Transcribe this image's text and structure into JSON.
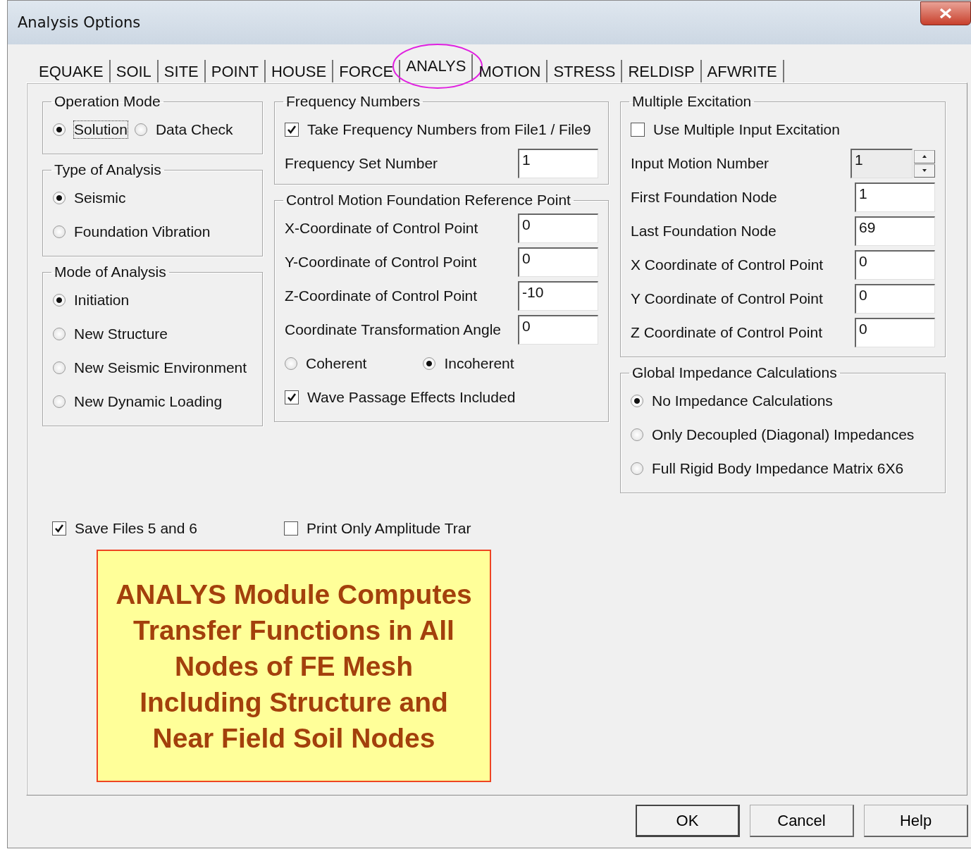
{
  "window": {
    "title": "Analysis Options"
  },
  "tabs": [
    {
      "label": "EQUAKE",
      "selected": false,
      "circled": false
    },
    {
      "label": "SOIL",
      "selected": false,
      "circled": false
    },
    {
      "label": "SITE",
      "selected": false,
      "circled": false
    },
    {
      "label": "POINT",
      "selected": false,
      "circled": false
    },
    {
      "label": "HOUSE",
      "selected": false,
      "circled": false
    },
    {
      "label": "FORCE",
      "selected": false,
      "circled": false
    },
    {
      "label": "ANALYS",
      "selected": true,
      "circled": true
    },
    {
      "label": "MOTION",
      "selected": false,
      "circled": false
    },
    {
      "label": "STRESS",
      "selected": false,
      "circled": false
    },
    {
      "label": "RELDISP",
      "selected": false,
      "circled": false
    },
    {
      "label": "AFWRITE",
      "selected": false,
      "circled": false
    }
  ],
  "columns": [
    {
      "groups": [
        {
          "title": "Operation Mode",
          "items": [
            {
              "kind": "radio_row",
              "options": [
                {
                  "label": "Solution",
                  "selected": true,
                  "focused": true
                },
                {
                  "label": "Data Check",
                  "selected": false,
                  "focused": false
                }
              ]
            }
          ]
        },
        {
          "title": "Type of Analysis",
          "items": [
            {
              "kind": "radio",
              "label": "Seismic",
              "selected": true
            },
            {
              "kind": "radio",
              "label": "Foundation Vibration",
              "selected": false
            }
          ]
        },
        {
          "title": "Mode of Analysis",
          "items": [
            {
              "kind": "radio",
              "label": "Initiation",
              "selected": true
            },
            {
              "kind": "radio",
              "label": "New Structure",
              "selected": false
            },
            {
              "kind": "radio",
              "label": "New Seismic Environment",
              "selected": false
            },
            {
              "kind": "radio",
              "label": "New Dynamic Loading",
              "selected": false
            }
          ]
        }
      ]
    },
    {
      "groups": [
        {
          "title": "Frequency Numbers",
          "items": [
            {
              "kind": "checkbox",
              "label": "Take Frequency Numbers from File1 / File9",
              "checked": true
            },
            {
              "kind": "field",
              "label": "Frequency Set Number",
              "value": "1",
              "disabled": false
            }
          ]
        },
        {
          "title": "Control Motion Foundation Reference Point",
          "items": [
            {
              "kind": "field",
              "label": "X-Coordinate of Control Point",
              "value": "0",
              "disabled": false
            },
            {
              "kind": "field",
              "label": "Y-Coordinate of Control Point",
              "value": "0",
              "disabled": false
            },
            {
              "kind": "field",
              "label": "Z-Coordinate of Control Point",
              "value": "-10",
              "disabled": false
            },
            {
              "kind": "field",
              "label": "Coordinate Transformation Angle",
              "value": "0",
              "disabled": false
            },
            {
              "kind": "radio_row",
              "options": [
                {
                  "label": "Coherent",
                  "selected": false,
                  "focused": false
                },
                {
                  "label": "Incoherent",
                  "selected": true,
                  "focused": false
                }
              ]
            },
            {
              "kind": "checkbox",
              "label": "Wave Passage Effects Included",
              "checked": true
            }
          ]
        }
      ]
    },
    {
      "groups": [
        {
          "title": "Multiple Excitation",
          "items": [
            {
              "kind": "checkbox",
              "label": "Use Multiple Input Excitation",
              "checked": false
            },
            {
              "kind": "spin",
              "label": "Input Motion Number",
              "value": "1",
              "disabled": true
            },
            {
              "kind": "field",
              "label": "First Foundation Node",
              "value": "1",
              "disabled": false
            },
            {
              "kind": "field",
              "label": "Last Foundation Node",
              "value": "69",
              "disabled": false
            },
            {
              "kind": "field",
              "label": "X Coordinate of Control Point",
              "value": "0",
              "disabled": false
            },
            {
              "kind": "field",
              "label": "Y Coordinate of Control Point",
              "value": "0",
              "disabled": false
            },
            {
              "kind": "field",
              "label": "Z Coordinate of Control Point",
              "value": "0",
              "disabled": false
            }
          ]
        },
        {
          "title": "Global Impedance Calculations",
          "items": [
            {
              "kind": "radio",
              "label": "No Impedance Calculations",
              "selected": true
            },
            {
              "kind": "radio",
              "label": "Only Decoupled (Diagonal) Impedances",
              "selected": false
            },
            {
              "kind": "radio",
              "label": "Full Rigid Body Impedance Matrix 6X6",
              "selected": false
            }
          ]
        }
      ]
    }
  ],
  "bottom_checks": [
    {
      "label": "Save Files 5 and 6",
      "checked": true
    },
    {
      "label": "Print Only Amplitude Trar",
      "checked": false
    }
  ],
  "callout": {
    "text": "ANALYS Module Computes Transfer Functions in All Nodes of FE Mesh Including Structure and Near Field Soil Nodes"
  },
  "buttons": [
    {
      "label": "OK",
      "default": true
    },
    {
      "label": "Cancel",
      "default": false
    },
    {
      "label": "Help",
      "default": false
    }
  ]
}
